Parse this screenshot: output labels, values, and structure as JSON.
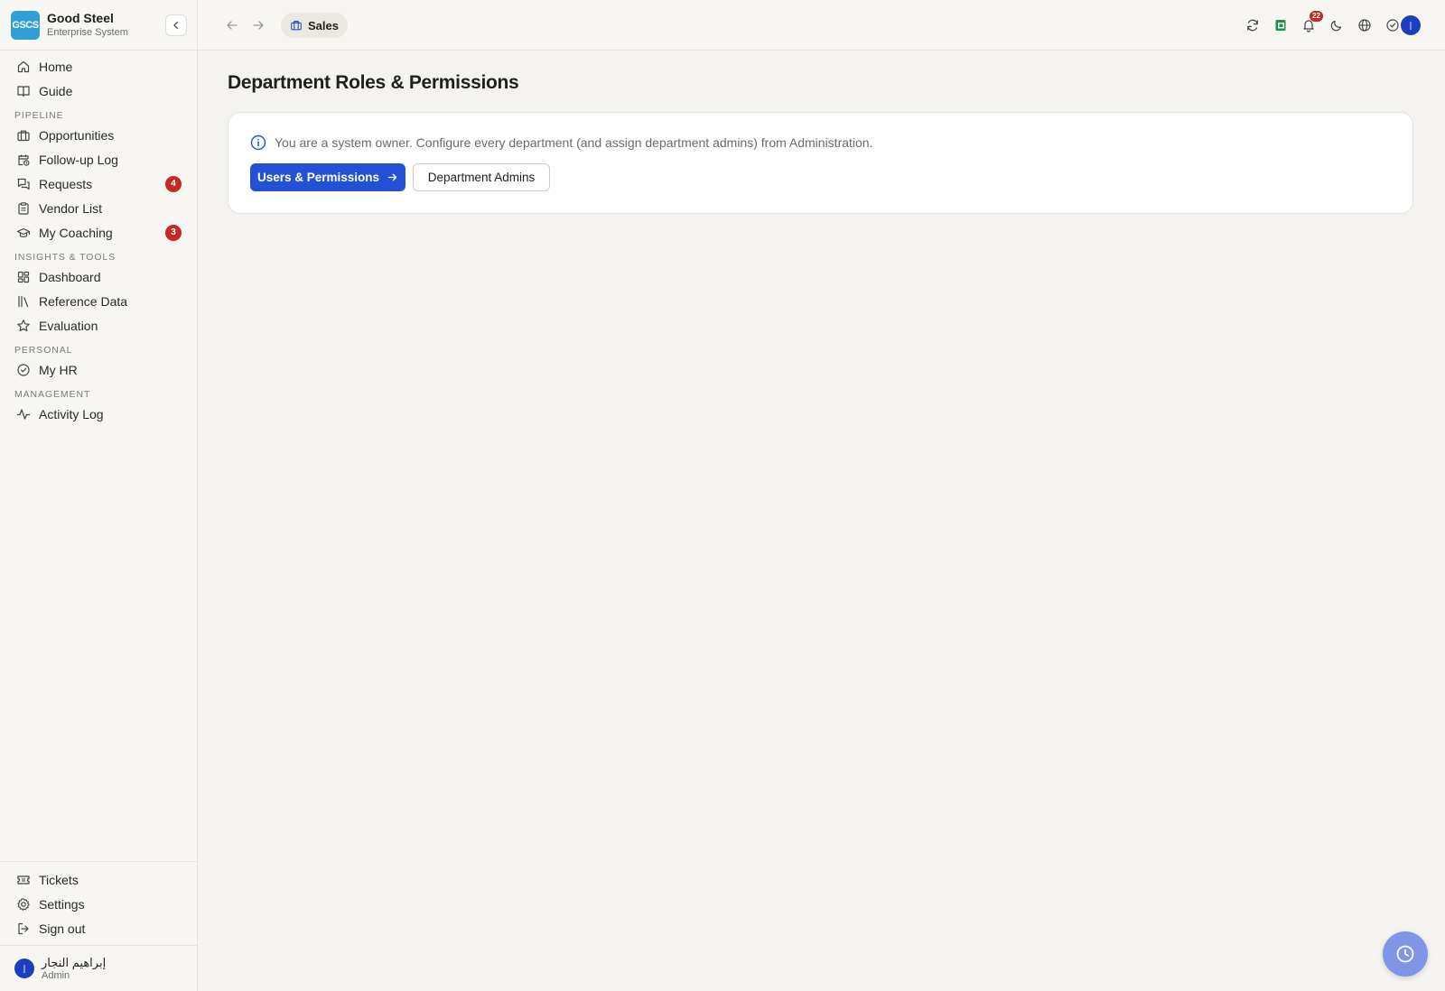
{
  "brand": {
    "logo_text": "GSCS",
    "name": "Good Steel",
    "subtitle": "Enterprise System"
  },
  "sidebar": {
    "top_items": [
      {
        "label": "Home",
        "icon": "home-icon"
      },
      {
        "label": "Guide",
        "icon": "book-icon"
      }
    ],
    "sections": [
      {
        "label": "PIPELINE",
        "items": [
          {
            "label": "Opportunities",
            "icon": "briefcase-icon"
          },
          {
            "label": "Follow-up Log",
            "icon": "calendar-clock-icon"
          },
          {
            "label": "Requests",
            "icon": "chat-bubbles-icon",
            "badge": "4"
          },
          {
            "label": "Vendor List",
            "icon": "clipboard-icon"
          },
          {
            "label": "My Coaching",
            "icon": "graduation-cap-icon",
            "badge": "3"
          }
        ]
      },
      {
        "label": "INSIGHTS & TOOLS",
        "items": [
          {
            "label": "Dashboard",
            "icon": "dashboard-grid-icon"
          },
          {
            "label": "Reference Data",
            "icon": "library-icon"
          },
          {
            "label": "Evaluation",
            "icon": "star-icon"
          }
        ]
      },
      {
        "label": "PERSONAL",
        "items": [
          {
            "label": "My HR",
            "icon": "check-circle-icon"
          }
        ]
      },
      {
        "label": "MANAGEMENT",
        "items": [
          {
            "label": "Activity Log",
            "icon": "activity-icon"
          }
        ]
      }
    ],
    "bottom_items": [
      {
        "label": "Tickets",
        "icon": "ticket-icon"
      },
      {
        "label": "Settings",
        "icon": "gear-icon"
      },
      {
        "label": "Sign out",
        "icon": "sign-out-icon"
      }
    ],
    "user": {
      "initials": "إ",
      "name": "إبراهيم النجار",
      "role": "Admin"
    }
  },
  "topbar": {
    "breadcrumb": "Sales",
    "notification_count": "22",
    "avatar_initials": "إ"
  },
  "main": {
    "title": "Department Roles & Permissions",
    "info_text": "You are a system owner. Configure every department (and assign department admins) from Administration.",
    "primary_button": "Users & Permissions",
    "secondary_button": "Department Admins"
  },
  "colors": {
    "accent": "#2450d6",
    "badge": "#c62828",
    "brand_logo": "#2f9fd6",
    "fab": "#7f95e8"
  }
}
